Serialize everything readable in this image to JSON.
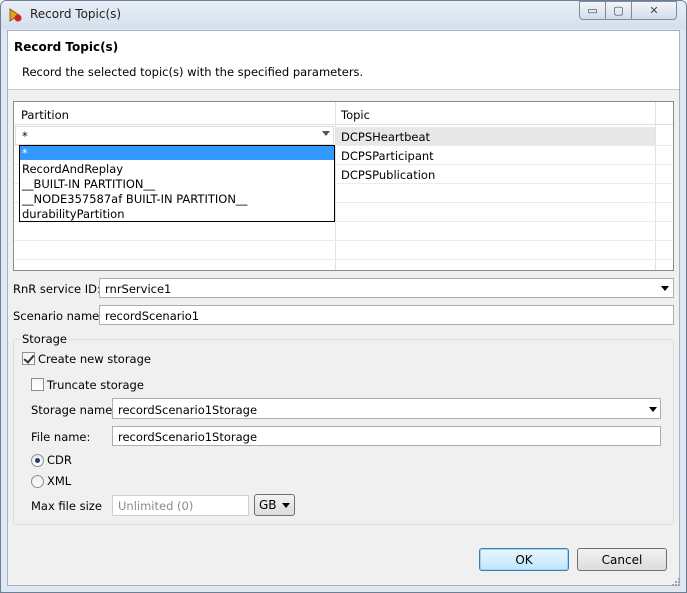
{
  "window": {
    "title": "Record Topic(s)",
    "controls": {
      "minimize": "▭",
      "maximize": "▢",
      "close": "✕"
    }
  },
  "header": {
    "title": "Record Topic(s)",
    "description": "Record the selected topic(s) with the specified parameters."
  },
  "table": {
    "columns": [
      "Partition",
      "Topic"
    ],
    "partition_value": "*",
    "topics": [
      "DCPSHeartbeat",
      "DCPSParticipant",
      "DCPSPublication"
    ],
    "dropdown_options": [
      "*",
      "RecordAndReplay",
      "__BUILT-IN PARTITION__",
      "__NODE357587af BUILT-IN PARTITION__",
      "durabilityPartition"
    ]
  },
  "form": {
    "rnr_service_label": "RnR service ID:",
    "rnr_service_value": "rnrService1",
    "scenario_label": "Scenario name:",
    "scenario_value": "recordScenario1"
  },
  "storage": {
    "group_label": "Storage",
    "create_new_label": "Create new storage",
    "create_new_checked": true,
    "truncate_label": "Truncate storage",
    "truncate_checked": false,
    "name_label": "Storage name:",
    "name_value": "recordScenario1Storage",
    "file_label": "File name:",
    "file_value": "recordScenario1Storage",
    "format_options": [
      "CDR",
      "XML"
    ],
    "format_selected": "CDR",
    "max_size_label": "Max file size",
    "max_size_value": "Unlimited (0)",
    "max_size_unit": "GB"
  },
  "buttons": {
    "ok": "OK",
    "cancel": "Cancel"
  },
  "colors": {
    "selection": "#3399ff",
    "default_button": "#bee6fd",
    "window_frame": "#dfe7f1"
  },
  "icons": {
    "app": "record-app-icon",
    "combo": "chevron-down-icon",
    "check": "check-icon",
    "grip": "resize-grip-icon"
  }
}
